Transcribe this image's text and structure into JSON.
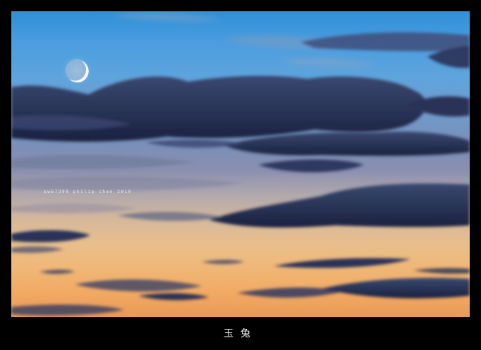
{
  "photo": {
    "watermark_text": "sw67399 philip chen 2010",
    "caption_text": "玉兔",
    "border_color": "#000000",
    "sky_top_color": "#2f8fd6",
    "sky_bottom_color": "#f2aa63",
    "cloud_color": "#1f2a4a",
    "moon_phase": "waxing crescent"
  }
}
